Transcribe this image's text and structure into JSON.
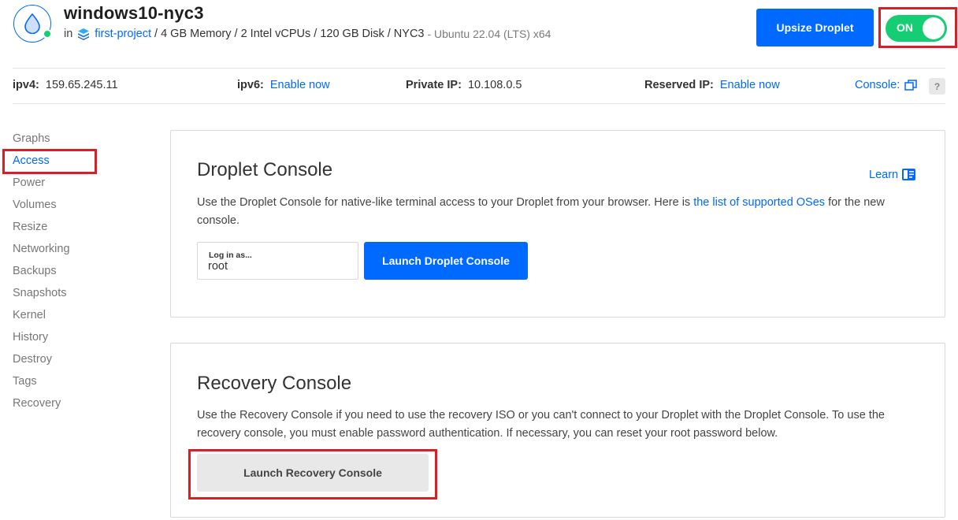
{
  "header": {
    "droplet_name": "windows10-nyc3",
    "in_word": "in",
    "project_name": "first-project",
    "specs": "/ 4 GB Memory / 2 Intel vCPUs / 120 GB Disk / NYC3",
    "os": "- Ubuntu 22.04 (LTS) x64",
    "upsize_label": "Upsize Droplet",
    "power_toggle_label": "ON",
    "status_color": "#15cd72",
    "brand_color": "#0069ff"
  },
  "ipbar": {
    "ipv4_label": "ipv4:",
    "ipv4_value": "159.65.245.11",
    "ipv6_label": "ipv6:",
    "ipv6_link": "Enable now",
    "private_label": "Private IP:",
    "private_value": "10.108.0.5",
    "reserved_label": "Reserved IP:",
    "reserved_link": "Enable now",
    "console_label": "Console:",
    "help_label": "?"
  },
  "sidebar": {
    "items": [
      {
        "label": "Graphs"
      },
      {
        "label": "Access",
        "active": true
      },
      {
        "label": "Power"
      },
      {
        "label": "Volumes"
      },
      {
        "label": "Resize"
      },
      {
        "label": "Networking"
      },
      {
        "label": "Backups"
      },
      {
        "label": "Snapshots"
      },
      {
        "label": "Kernel"
      },
      {
        "label": "History"
      },
      {
        "label": "Destroy"
      },
      {
        "label": "Tags"
      },
      {
        "label": "Recovery"
      }
    ]
  },
  "droplet_console": {
    "title": "Droplet Console",
    "learn_label": "Learn",
    "desc_before": "Use the Droplet Console for native-like terminal access to your Droplet from your browser. Here is ",
    "desc_link": "the list of supported OSes",
    "desc_after": " for the new console.",
    "login_label": "Log in as...",
    "login_value": "root",
    "launch_label": "Launch Droplet Console"
  },
  "recovery_console": {
    "title": "Recovery Console",
    "desc": "Use the Recovery Console if you need to use the recovery ISO or you can't connect to your Droplet with the Droplet Console. To use the recovery console, you must enable password authentication. If necessary, you can reset your root password below.",
    "launch_label": "Launch Recovery Console"
  }
}
